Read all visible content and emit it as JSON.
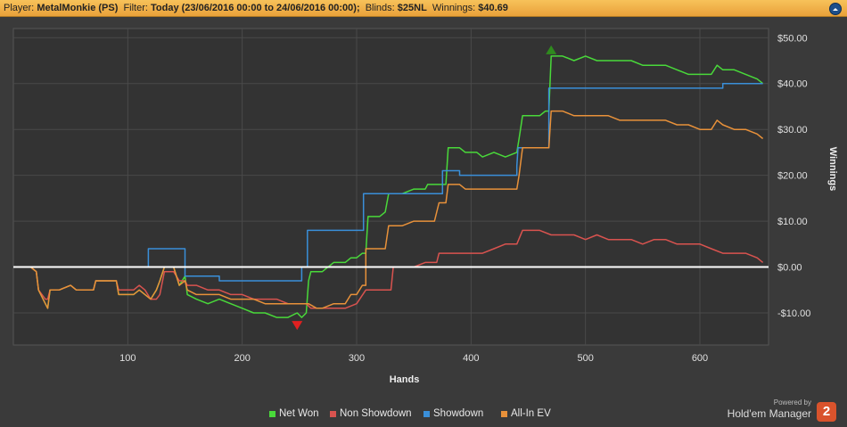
{
  "header": {
    "player_label": "Player:",
    "player_value": "MetalMonkie (PS)",
    "filter_label": "Filter:",
    "filter_value": "Today (23/06/2016 00:00 to 24/06/2016 00:00);",
    "blinds_label": "Blinds:",
    "blinds_value": "$25NL",
    "winnings_label": "Winnings:",
    "winnings_value": "$40.69"
  },
  "brand": {
    "powered_by": "Powered by",
    "name": "Hold'em Manager",
    "logo": "2"
  },
  "chart_data": {
    "type": "line",
    "xlabel": "Hands",
    "ylabel": "Winnings",
    "xlim": [
      0,
      660
    ],
    "ylim": [
      -17,
      52
    ],
    "x_ticks": [
      100,
      200,
      300,
      400,
      500,
      600
    ],
    "y_ticks": [
      -10,
      0,
      10,
      20,
      30,
      40,
      50
    ],
    "y_tick_labels": [
      "-$10.00",
      "$0.00",
      "$10.00",
      "$20.00",
      "$30.00",
      "$40.00",
      "$50.00"
    ],
    "legend_position": "bottom",
    "colors": {
      "background": "#333333",
      "grid": "#4a4a4a",
      "zero_line": "#ffffff"
    },
    "series": [
      {
        "name": "Net Won",
        "color": "#49d93a",
        "points": [
          [
            0,
            0
          ],
          [
            15,
            0
          ],
          [
            20,
            -1
          ],
          [
            22,
            -5
          ],
          [
            28,
            -8
          ],
          [
            30,
            -9
          ],
          [
            32,
            -5
          ],
          [
            40,
            -5
          ],
          [
            50,
            -4
          ],
          [
            55,
            -5
          ],
          [
            62,
            -5
          ],
          [
            70,
            -5
          ],
          [
            72,
            -3
          ],
          [
            80,
            -3
          ],
          [
            90,
            -3
          ],
          [
            92,
            -6
          ],
          [
            105,
            -6
          ],
          [
            110,
            -5
          ],
          [
            115,
            -6
          ],
          [
            120,
            -7
          ],
          [
            125,
            -5
          ],
          [
            128,
            -3
          ],
          [
            132,
            0
          ],
          [
            140,
            0
          ],
          [
            145,
            -4
          ],
          [
            150,
            -2
          ],
          [
            152,
            -6
          ],
          [
            160,
            -7
          ],
          [
            170,
            -8
          ],
          [
            180,
            -7
          ],
          [
            190,
            -8
          ],
          [
            200,
            -9
          ],
          [
            210,
            -10
          ],
          [
            220,
            -10
          ],
          [
            230,
            -11
          ],
          [
            240,
            -11
          ],
          [
            248,
            -10
          ],
          [
            252,
            -11
          ],
          [
            256,
            -10
          ],
          [
            258,
            -3
          ],
          [
            260,
            -1
          ],
          [
            270,
            -1
          ],
          [
            280,
            1
          ],
          [
            290,
            1
          ],
          [
            295,
            2
          ],
          [
            300,
            2
          ],
          [
            305,
            3
          ],
          [
            308,
            3
          ],
          [
            310,
            11
          ],
          [
            320,
            11
          ],
          [
            325,
            12
          ],
          [
            328,
            16
          ],
          [
            340,
            16
          ],
          [
            350,
            17
          ],
          [
            360,
            17
          ],
          [
            362,
            18
          ],
          [
            368,
            18
          ],
          [
            372,
            18
          ],
          [
            378,
            18
          ],
          [
            380,
            26
          ],
          [
            390,
            26
          ],
          [
            395,
            25
          ],
          [
            400,
            25
          ],
          [
            405,
            25
          ],
          [
            410,
            24
          ],
          [
            420,
            25
          ],
          [
            430,
            24
          ],
          [
            440,
            25
          ],
          [
            442,
            28
          ],
          [
            445,
            33
          ],
          [
            450,
            33
          ],
          [
            460,
            33
          ],
          [
            465,
            34
          ],
          [
            468,
            34
          ],
          [
            470,
            46
          ],
          [
            480,
            46
          ],
          [
            490,
            45
          ],
          [
            500,
            46
          ],
          [
            510,
            45
          ],
          [
            520,
            45
          ],
          [
            530,
            45
          ],
          [
            540,
            45
          ],
          [
            550,
            44
          ],
          [
            560,
            44
          ],
          [
            570,
            44
          ],
          [
            580,
            43
          ],
          [
            590,
            42
          ],
          [
            600,
            42
          ],
          [
            610,
            42
          ],
          [
            615,
            44
          ],
          [
            620,
            43
          ],
          [
            630,
            43
          ],
          [
            640,
            42
          ],
          [
            650,
            41
          ],
          [
            655,
            40
          ]
        ]
      },
      {
        "name": "Non Showdown",
        "color": "#d9534f",
        "points": [
          [
            0,
            0
          ],
          [
            15,
            0
          ],
          [
            20,
            -1
          ],
          [
            22,
            -5
          ],
          [
            28,
            -7
          ],
          [
            30,
            -7
          ],
          [
            32,
            -5
          ],
          [
            40,
            -5
          ],
          [
            50,
            -4
          ],
          [
            55,
            -5
          ],
          [
            62,
            -5
          ],
          [
            70,
            -5
          ],
          [
            72,
            -3
          ],
          [
            80,
            -3
          ],
          [
            90,
            -3
          ],
          [
            92,
            -5
          ],
          [
            105,
            -5
          ],
          [
            110,
            -4
          ],
          [
            115,
            -5
          ],
          [
            120,
            -7
          ],
          [
            125,
            -7
          ],
          [
            128,
            -6
          ],
          [
            132,
            -1
          ],
          [
            140,
            -1
          ],
          [
            145,
            -3
          ],
          [
            150,
            -3
          ],
          [
            152,
            -4
          ],
          [
            160,
            -4
          ],
          [
            170,
            -5
          ],
          [
            180,
            -5
          ],
          [
            190,
            -6
          ],
          [
            200,
            -6
          ],
          [
            210,
            -7
          ],
          [
            220,
            -7
          ],
          [
            230,
            -7
          ],
          [
            240,
            -8
          ],
          [
            250,
            -8
          ],
          [
            256,
            -8
          ],
          [
            260,
            -9
          ],
          [
            270,
            -9
          ],
          [
            280,
            -9
          ],
          [
            290,
            -9
          ],
          [
            300,
            -8
          ],
          [
            308,
            -5
          ],
          [
            312,
            -5
          ],
          [
            320,
            -5
          ],
          [
            330,
            -5
          ],
          [
            332,
            0
          ],
          [
            340,
            0
          ],
          [
            350,
            0
          ],
          [
            360,
            1
          ],
          [
            370,
            1
          ],
          [
            372,
            3
          ],
          [
            380,
            3
          ],
          [
            390,
            3
          ],
          [
            400,
            3
          ],
          [
            410,
            3
          ],
          [
            420,
            4
          ],
          [
            430,
            5
          ],
          [
            440,
            5
          ],
          [
            445,
            8
          ],
          [
            450,
            8
          ],
          [
            460,
            8
          ],
          [
            470,
            7
          ],
          [
            480,
            7
          ],
          [
            490,
            7
          ],
          [
            500,
            6
          ],
          [
            510,
            7
          ],
          [
            520,
            6
          ],
          [
            530,
            6
          ],
          [
            540,
            6
          ],
          [
            550,
            5
          ],
          [
            560,
            6
          ],
          [
            570,
            6
          ],
          [
            580,
            5
          ],
          [
            590,
            5
          ],
          [
            600,
            5
          ],
          [
            610,
            4
          ],
          [
            620,
            3
          ],
          [
            630,
            3
          ],
          [
            640,
            3
          ],
          [
            650,
            2
          ],
          [
            655,
            1
          ]
        ]
      },
      {
        "name": "Showdown",
        "color": "#3a8fd9",
        "points": [
          [
            0,
            0
          ],
          [
            118,
            0
          ],
          [
            118,
            4
          ],
          [
            150,
            4
          ],
          [
            150,
            -2
          ],
          [
            180,
            -2
          ],
          [
            180,
            -3
          ],
          [
            252,
            -3
          ],
          [
            252,
            0
          ],
          [
            257,
            0
          ],
          [
            257,
            8
          ],
          [
            306,
            8
          ],
          [
            306,
            16
          ],
          [
            371,
            16
          ],
          [
            371,
            16
          ],
          [
            375,
            16
          ],
          [
            375,
            21
          ],
          [
            390,
            21
          ],
          [
            390,
            20
          ],
          [
            440,
            20
          ],
          [
            440,
            22
          ],
          [
            441,
            26
          ],
          [
            468,
            26
          ],
          [
            468,
            39
          ],
          [
            620,
            39
          ],
          [
            620,
            40
          ],
          [
            655,
            40
          ]
        ]
      },
      {
        "name": "All-In EV",
        "color": "#e8913a",
        "points": [
          [
            0,
            0
          ],
          [
            15,
            0
          ],
          [
            20,
            -1
          ],
          [
            22,
            -5
          ],
          [
            28,
            -8
          ],
          [
            30,
            -9
          ],
          [
            32,
            -5
          ],
          [
            40,
            -5
          ],
          [
            50,
            -4
          ],
          [
            55,
            -5
          ],
          [
            62,
            -5
          ],
          [
            70,
            -5
          ],
          [
            72,
            -3
          ],
          [
            80,
            -3
          ],
          [
            90,
            -3
          ],
          [
            92,
            -6
          ],
          [
            105,
            -6
          ],
          [
            110,
            -5
          ],
          [
            115,
            -6
          ],
          [
            120,
            -7
          ],
          [
            125,
            -5
          ],
          [
            128,
            -3
          ],
          [
            132,
            0
          ],
          [
            140,
            0
          ],
          [
            145,
            -4
          ],
          [
            150,
            -3
          ],
          [
            152,
            -5
          ],
          [
            160,
            -6
          ],
          [
            170,
            -6
          ],
          [
            180,
            -6
          ],
          [
            190,
            -7
          ],
          [
            200,
            -7
          ],
          [
            210,
            -7
          ],
          [
            220,
            -8
          ],
          [
            230,
            -8
          ],
          [
            240,
            -8
          ],
          [
            250,
            -8
          ],
          [
            255,
            -8
          ],
          [
            258,
            -8
          ],
          [
            265,
            -9
          ],
          [
            270,
            -9
          ],
          [
            280,
            -8
          ],
          [
            290,
            -8
          ],
          [
            295,
            -6
          ],
          [
            300,
            -6
          ],
          [
            305,
            -4
          ],
          [
            308,
            -4
          ],
          [
            308,
            4
          ],
          [
            320,
            4
          ],
          [
            325,
            4
          ],
          [
            328,
            9
          ],
          [
            340,
            9
          ],
          [
            350,
            10
          ],
          [
            360,
            10
          ],
          [
            365,
            10
          ],
          [
            368,
            10
          ],
          [
            372,
            14
          ],
          [
            378,
            14
          ],
          [
            380,
            18
          ],
          [
            390,
            18
          ],
          [
            395,
            17
          ],
          [
            400,
            17
          ],
          [
            405,
            17
          ],
          [
            410,
            17
          ],
          [
            420,
            17
          ],
          [
            430,
            17
          ],
          [
            440,
            17
          ],
          [
            442,
            20
          ],
          [
            445,
            26
          ],
          [
            450,
            26
          ],
          [
            460,
            26
          ],
          [
            465,
            26
          ],
          [
            468,
            26
          ],
          [
            470,
            34
          ],
          [
            480,
            34
          ],
          [
            490,
            33
          ],
          [
            500,
            33
          ],
          [
            510,
            33
          ],
          [
            520,
            33
          ],
          [
            530,
            32
          ],
          [
            540,
            32
          ],
          [
            550,
            32
          ],
          [
            560,
            32
          ],
          [
            570,
            32
          ],
          [
            580,
            31
          ],
          [
            590,
            31
          ],
          [
            600,
            30
          ],
          [
            610,
            30
          ],
          [
            615,
            32
          ],
          [
            620,
            31
          ],
          [
            630,
            30
          ],
          [
            640,
            30
          ],
          [
            650,
            29
          ],
          [
            655,
            28
          ]
        ]
      }
    ],
    "markers": [
      {
        "type": "max",
        "series": "Net Won",
        "x": 470,
        "y": 46,
        "color": "#2f8a1e"
      },
      {
        "type": "min",
        "series": "Net Won",
        "x": 248,
        "y": -11,
        "color": "#e02020"
      }
    ]
  }
}
